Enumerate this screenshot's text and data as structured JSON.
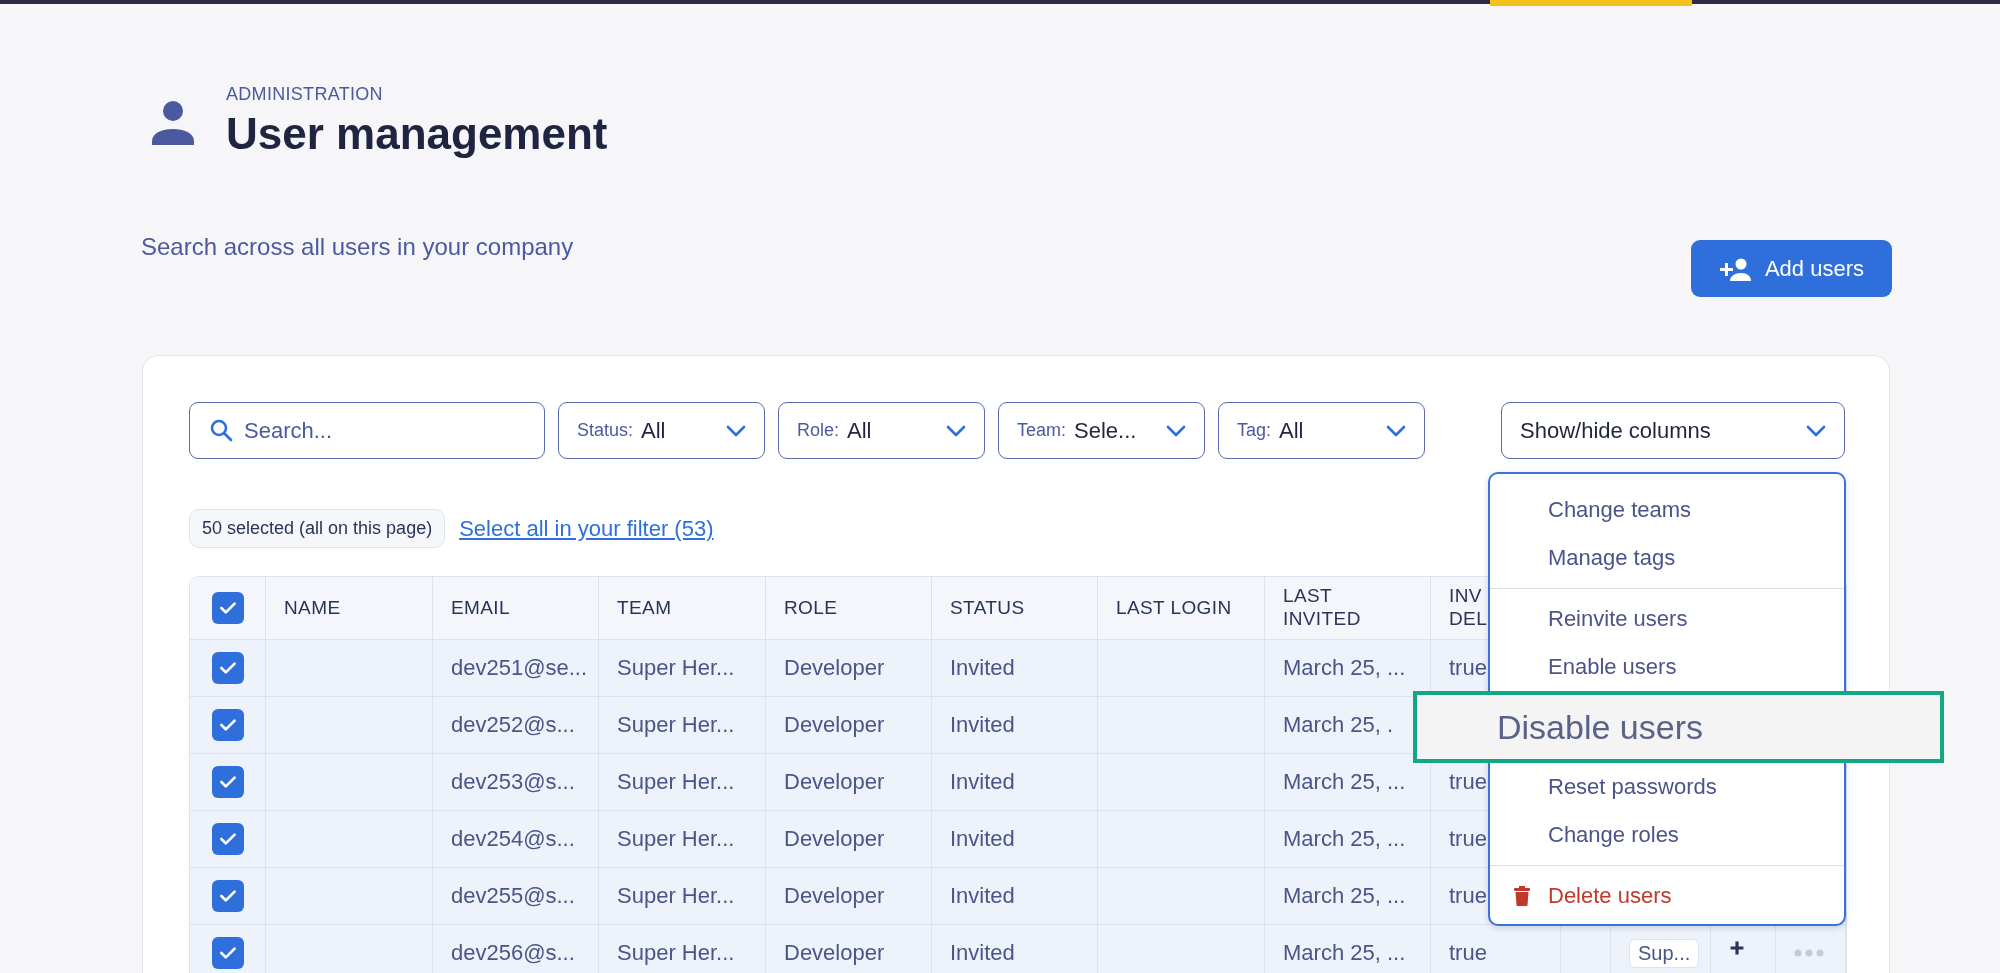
{
  "header": {
    "eyebrow": "ADMINISTRATION",
    "title": "User management",
    "subtitle": "Search across all users in your company"
  },
  "add_button": {
    "label": "Add users"
  },
  "search": {
    "placeholder": "Search..."
  },
  "filters": [
    {
      "label": "Status:",
      "value": "All"
    },
    {
      "label": "Role:",
      "value": "All"
    },
    {
      "label": "Team:",
      "value": "Sele..."
    },
    {
      "label": "Tag:",
      "value": "All"
    }
  ],
  "columns_button": {
    "label": "Show/hide columns"
  },
  "selection": {
    "count": "50 selected (all on this page)",
    "link": "Select all in your filter (53)"
  },
  "table": {
    "select_all": {
      "checked": true
    },
    "columns": [
      "NAME",
      "EMAIL",
      "TEAM",
      "ROLE",
      "STATUS",
      "LAST LOGIN",
      "LAST INVITED",
      "INV DEL"
    ],
    "rows": [
      {
        "selected": true,
        "email": "dev251@se...",
        "team": "Super Her...",
        "role": "Developer",
        "status": "Invited",
        "last_invited": "March 25, ...",
        "column_9": "true"
      },
      {
        "selected": true,
        "email": "dev252@s...",
        "team": "Super Her...",
        "role": "Developer",
        "status": "Invited",
        "last_invited": "March 25, ."
      },
      {
        "selected": true,
        "email": "dev253@s...",
        "team": "Super Her...",
        "role": "Developer",
        "status": "Invited",
        "last_invited": "March 25, ...",
        "column_9": "true"
      },
      {
        "selected": true,
        "email": "dev254@s...",
        "team": "Super Her...",
        "role": "Developer",
        "status": "Invited",
        "last_invited": "March 25, ...",
        "column_9": "true"
      },
      {
        "selected": true,
        "email": "dev255@s...",
        "team": "Super Her...",
        "role": "Developer",
        "status": "Invited",
        "last_invited": "March 25, ...",
        "column_9": "true"
      },
      {
        "selected": true,
        "email": "dev256@s...",
        "team": "Super Her...",
        "role": "Developer",
        "status": "Invited",
        "last_invited": "March 25, ...",
        "column_9": "true",
        "tag": "Sup..."
      }
    ]
  },
  "menu": {
    "groups": [
      [
        {
          "label": "Change teams",
          "kind": "normal"
        },
        {
          "label": "Manage tags",
          "kind": "normal"
        }
      ],
      [
        {
          "label": "Reinvite users",
          "kind": "normal"
        },
        {
          "label": "Enable users",
          "kind": "normal"
        },
        {
          "label": "Disable users",
          "kind": "zoomed"
        },
        {
          "label": "Reset passwords",
          "kind": "normal"
        },
        {
          "label": "Change roles",
          "kind": "normal"
        }
      ],
      [
        {
          "label": "Delete users",
          "kind": "danger"
        }
      ]
    ]
  }
}
